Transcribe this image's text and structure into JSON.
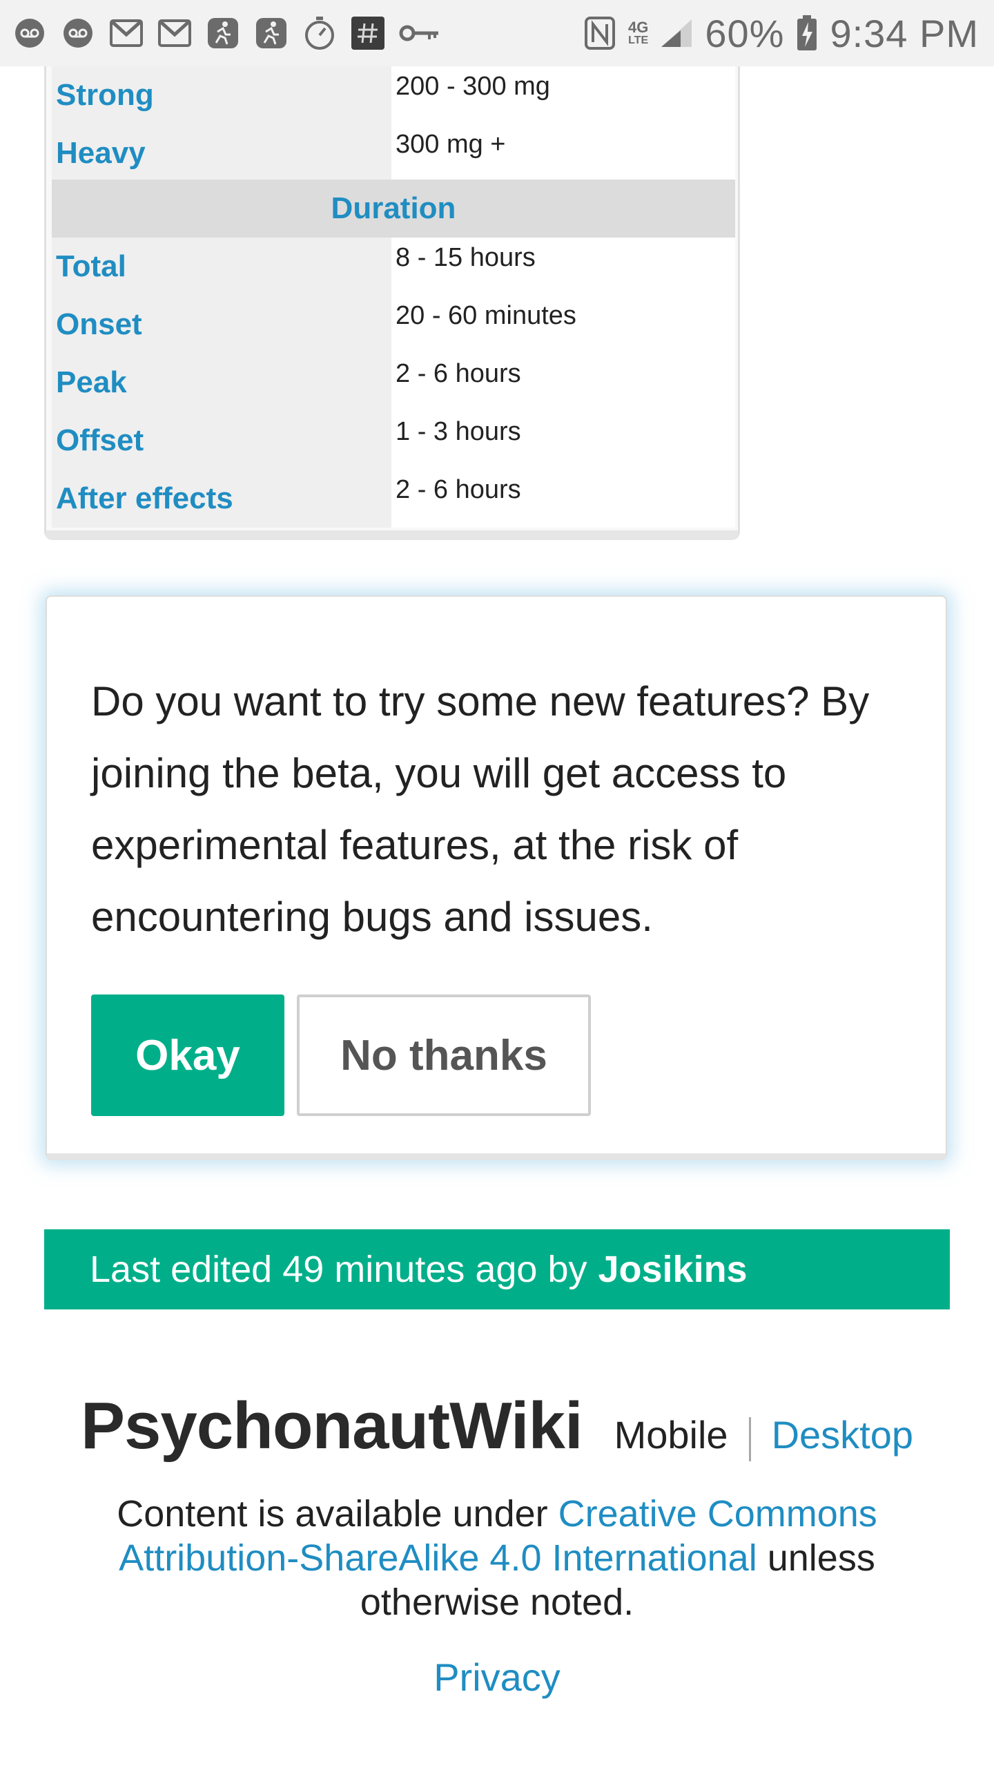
{
  "status_bar": {
    "left_icons": [
      "voicemail-icon",
      "voicemail-icon",
      "gmail-icon",
      "gmail-icon",
      "fitness-runner-icon",
      "fitness-runner-icon",
      "stopwatch-icon",
      "hashtag-icon",
      "key-icon"
    ],
    "right_icons": [
      "nfc-icon",
      "lte-icon",
      "signal-icon",
      "battery-charging-icon"
    ],
    "network_label": "4G",
    "network_sublabel": "LTE",
    "battery": "60%",
    "time": "9:34 PM"
  },
  "infobox": {
    "rows_top": [
      {
        "label": "Strong",
        "value": "200 - 300 mg"
      },
      {
        "label": "Heavy",
        "value": "300 mg +"
      }
    ],
    "section_header": "Duration",
    "rows_duration": [
      {
        "label": "Total",
        "value": "8 - 15 hours"
      },
      {
        "label": "Onset",
        "value": "20 - 60 minutes"
      },
      {
        "label": "Peak",
        "value": "2 - 6 hours"
      },
      {
        "label": "Offset",
        "value": "1 - 3 hours"
      },
      {
        "label": "After effects",
        "value": "2 - 6 hours"
      }
    ]
  },
  "beta_prompt": {
    "message": "Do you want to try some new features? By joining the beta, you will get access to experimental features, at the risk of encountering bugs and issues.",
    "okay_label": "Okay",
    "no_thanks_label": "No thanks"
  },
  "last_edited": {
    "prefix": "Last edited 49 minutes ago by",
    "user": "Josikins"
  },
  "footer": {
    "brand": "PsychonautWiki",
    "mobile_label": "Mobile",
    "desktop_label": "Desktop",
    "license_prefix": "Content is available under ",
    "license_link": "Creative Commons Attribution-ShareAlike 4.0 International",
    "license_suffix": " unless otherwise noted.",
    "privacy_label": "Privacy"
  },
  "colors": {
    "accent_green": "#00af89",
    "link_blue": "#1f8dc2",
    "status_bar_bg": "#f2f2f2"
  }
}
